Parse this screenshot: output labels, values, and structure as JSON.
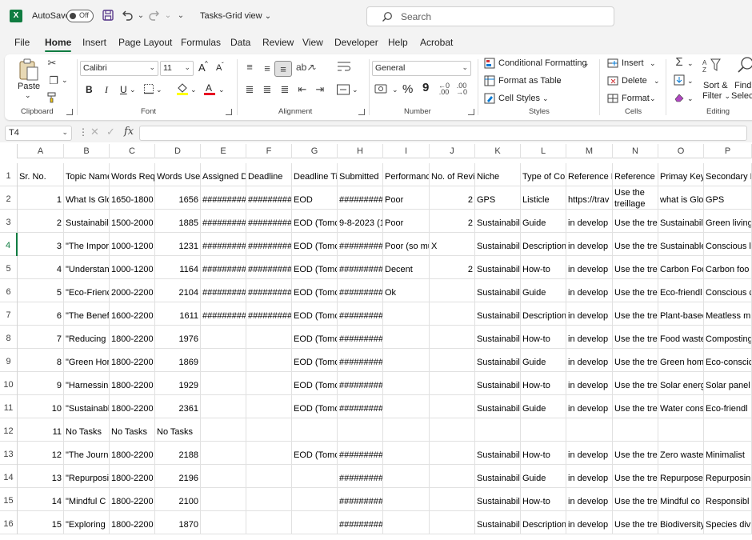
{
  "titlebar": {
    "app_icon": "X",
    "autosave_label": "AutoSave",
    "autosave_state": "Off",
    "title": "Tasks-Grid view",
    "title_chevron": "⌄",
    "undo_chevron": "⌄",
    "redo_chevron": "⌄",
    "customize_icon": "⌄"
  },
  "search": {
    "placeholder": "Search"
  },
  "tabs": [
    "File",
    "Home",
    "Insert",
    "Page Layout",
    "Formulas",
    "Data",
    "Review",
    "View",
    "Developer",
    "Help",
    "Acrobat"
  ],
  "ribbon": {
    "clipboard": {
      "label": "Clipboard",
      "paste": "Paste"
    },
    "font": {
      "label": "Font",
      "name": "Calibri",
      "size": "11",
      "grow": "A",
      "shrink": "A",
      "bold": "B",
      "italic": "I",
      "underline": "U"
    },
    "alignment": {
      "label": "Alignment"
    },
    "number": {
      "label": "Number",
      "format": "General",
      "percent": "%",
      "comma": "9"
    },
    "styles": {
      "label": "Styles",
      "conditional": "Conditional Formatting",
      "format_table": "Format as Table",
      "cell_styles": "Cell Styles"
    },
    "cells": {
      "label": "Cells",
      "insert": "Insert",
      "delete": "Delete",
      "format": "Format"
    },
    "editing": {
      "label": "Editing",
      "sort1": "Sort &",
      "sort2": "Filter",
      "find1": "Find",
      "find2": "Select"
    }
  },
  "formula_bar": {
    "name_box": "T4",
    "fx": "fx",
    "formula": ""
  },
  "columns": [
    "A",
    "B",
    "C",
    "D",
    "E",
    "F",
    "G",
    "H",
    "I",
    "J",
    "K",
    "L",
    "M",
    "N",
    "O",
    "P"
  ],
  "rows": [
    {
      "n": "1",
      "cells": [
        "Sr. No.",
        "Topic Name",
        "Words Requ",
        "Words Used",
        "Assigned D",
        "Deadline",
        "Deadline Ti",
        "Submitted",
        "Performance",
        "No. of Revi",
        "Niche",
        "Type of Con",
        "Reference L",
        "Reference L",
        "Primay Key",
        "Secondary K"
      ]
    },
    {
      "n": "2",
      "cells": [
        "1",
        "What Is Glo",
        "1650-1800",
        "1656",
        "#########",
        "#########",
        "EOD",
        "#########",
        "Poor",
        "2",
        "GPS",
        "Listicle",
        "https://trav",
        "Use the treillage",
        "what is Glonass",
        "GPS"
      ]
    },
    {
      "n": "3",
      "cells": [
        "2",
        "Sustainabil",
        "1500-2000",
        "1885",
        "#########",
        "#########",
        "EOD (Tomo",
        "9-8-2023 (1",
        "Poor",
        "2",
        "Sustainabil",
        "Guide",
        "in develop",
        "Use the tre",
        "Sustainabil",
        "Green living"
      ]
    },
    {
      "n": "4",
      "cells": [
        "3",
        "\"The Impor",
        "1000-1200",
        "1231",
        "#########",
        "#########",
        "EOD (Tomo",
        "#########",
        "Poor (so mu",
        "X",
        "Sustainabil",
        "Description",
        "in develop",
        "Use the tre",
        "Sustainable",
        "Conscious l"
      ]
    },
    {
      "n": "5",
      "cells": [
        "4",
        "\"Understan",
        "1000-1200",
        "1164",
        "#########",
        "#########",
        "EOD (Tomo",
        "#########",
        "Decent",
        "2",
        "Sustainabil",
        "How-to",
        "in develop",
        "Use the tre",
        "Carbon Foo",
        "Carbon foo"
      ]
    },
    {
      "n": "6",
      "cells": [
        "5",
        "\"Eco-Frienc",
        "2000-2200",
        "2104",
        "#########",
        "#########",
        "EOD (Tomo",
        "#########",
        "Ok",
        "",
        "Sustainabil",
        "Guide",
        "in develop",
        "Use the tre",
        "Eco-friendl",
        "Conscious c"
      ]
    },
    {
      "n": "7",
      "cells": [
        "6",
        "\"The Benef",
        "1600-2200",
        "1611",
        "#########",
        "#########",
        "EOD (Tomo",
        "#########",
        "",
        "",
        "Sustainabil",
        "Description",
        "in develop",
        "Use the tre",
        "Plant-basec",
        "Meatless m"
      ]
    },
    {
      "n": "8",
      "cells": [
        "7",
        "\"Reducing",
        "1800-2200",
        "1976",
        "",
        "",
        "EOD (Tomo",
        "#########",
        "",
        "",
        "Sustainabil",
        "How-to",
        "in develop",
        "Use the tre",
        "Food waste",
        "Composting"
      ]
    },
    {
      "n": "9",
      "cells": [
        "8",
        "\"Green Hor",
        "1800-2200",
        "1869",
        "",
        "",
        "EOD (Tomo",
        "#########",
        "",
        "",
        "Sustainabil",
        "Guide",
        "in develop",
        "Use the tre",
        "Green hom",
        "Eco-conscic"
      ]
    },
    {
      "n": "10",
      "cells": [
        "9",
        "\"Harnessin",
        "1800-2200",
        "1929",
        "",
        "",
        "EOD (Tomo",
        "#########",
        "",
        "",
        "Sustainabil",
        "How-to",
        "in develop",
        "Use the tre",
        "Solar energ",
        "Solar panel"
      ]
    },
    {
      "n": "11",
      "cells": [
        "10",
        "\"Sustainabl",
        "1800-2200",
        "2361",
        "",
        "",
        "EOD (Tomo",
        "#########",
        "",
        "",
        "Sustainabil",
        "Guide",
        "in develop",
        "Use the tre",
        "Water cons",
        "Eco-friendl"
      ]
    },
    {
      "n": "12",
      "cells": [
        "11",
        "No Tasks",
        "No Tasks",
        "No Tasks",
        "",
        "",
        "",
        "",
        "",
        "",
        "",
        "",
        "",
        "",
        "",
        ""
      ]
    },
    {
      "n": "13",
      "cells": [
        "12",
        "\"The Journ",
        "1800-2200",
        "2188",
        "",
        "",
        "EOD (Tomo",
        "#########",
        "",
        "",
        "Sustainabil",
        "How-to",
        "in develop",
        "Use the tre",
        "Zero waste",
        "Minimalist"
      ]
    },
    {
      "n": "14",
      "cells": [
        "13",
        "\"Repurposi",
        "1800-2200",
        "2196",
        "",
        "",
        "",
        "#########",
        "",
        "",
        "Sustainabil",
        "Guide",
        "in develop",
        "Use the tre",
        "Repurposec",
        "Repurposin"
      ]
    },
    {
      "n": "15",
      "cells": [
        "14",
        "\"Mindful C",
        "1800-2200",
        "2100",
        "",
        "",
        "",
        "#########",
        "",
        "",
        "Sustainabil",
        "How-to",
        "in develop",
        "Use the tre",
        "Mindful co",
        "Responsibl"
      ]
    },
    {
      "n": "16",
      "cells": [
        "15",
        "\"Exploring",
        "1800-2200",
        "1870",
        "",
        "",
        "",
        "#########",
        "",
        "",
        "Sustainabil",
        "Description",
        "in develop",
        "Use the tre",
        "Biodiversity",
        "Species div"
      ]
    }
  ],
  "selected_row": "4",
  "colors": {
    "accent": "#107c41",
    "grid_line": "#e1e1e1",
    "chrome": "#f3f3f3"
  }
}
